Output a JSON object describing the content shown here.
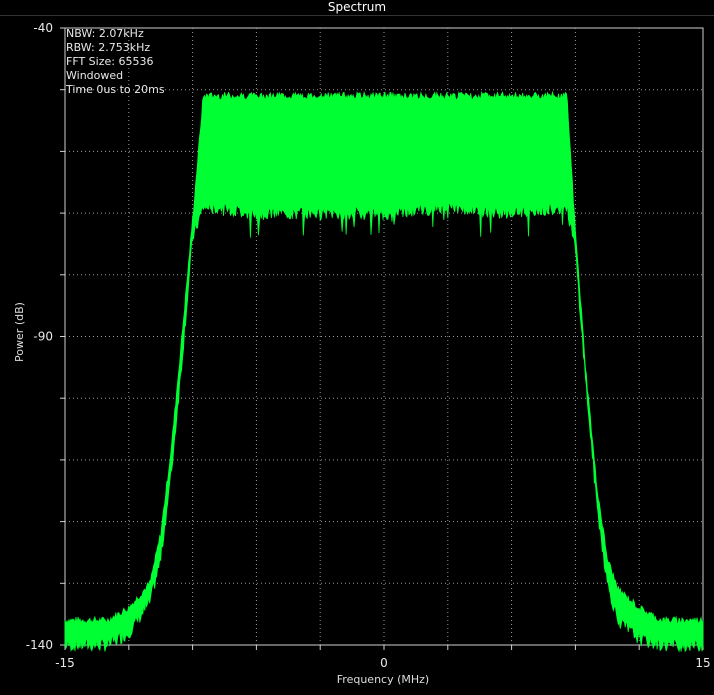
{
  "window": {
    "title": "Spectrum"
  },
  "info_lines": [
    "NBW: 2.07kHz",
    "RBW: 2.753kHz",
    "FFT Size: 65536",
    "Windowed",
    "Time 0us to 20ms"
  ],
  "chart_data": {
    "type": "area",
    "title": "Spectrum",
    "xlabel": "Frequency (MHz)",
    "ylabel": "Power (dB)",
    "xlim": [
      -15,
      15
    ],
    "ylim": [
      -140,
      -40
    ],
    "x_ticks": [
      -15,
      0,
      15
    ],
    "y_ticks": [
      -40,
      -90,
      -140
    ],
    "grid": true,
    "colors": {
      "signal": "#00ff33",
      "grid": "#9a9a9a",
      "background": "#000000"
    },
    "series": [
      {
        "x": [
          -15,
          -13,
          -12,
          -11,
          -10.5,
          -10,
          -9.5,
          -9.0,
          -8.5,
          -8.4,
          -6,
          -3,
          0,
          3,
          6,
          8.4,
          8.6,
          9.0,
          9.5,
          10,
          10.5,
          11,
          12,
          13,
          15
        ],
        "upper": [
          -136,
          -136,
          -134,
          -130,
          -122,
          -108,
          -90,
          -71,
          -51,
          -51,
          -51,
          -51,
          -51,
          -51,
          -51,
          -51,
          -51,
          -73,
          -96,
          -114,
          -126,
          -131,
          -134,
          -136,
          -136
        ],
        "lower": [
          -140,
          -140,
          -138,
          -133,
          -126,
          -112,
          -94,
          -74,
          -69,
          -69,
          -70,
          -70,
          -70,
          -69,
          -70,
          -69,
          -69,
          -76,
          -98,
          -117,
          -130,
          -136,
          -139,
          -140,
          -140
        ]
      }
    ]
  }
}
